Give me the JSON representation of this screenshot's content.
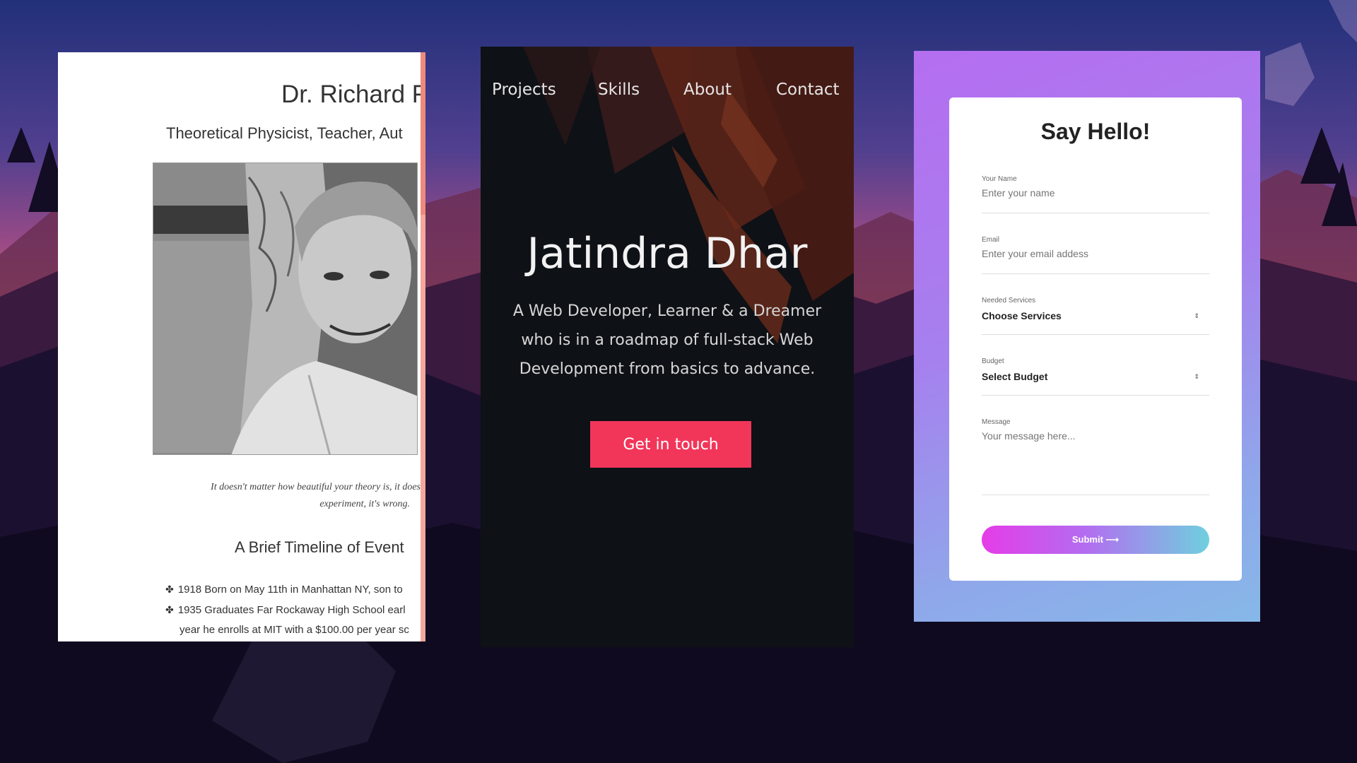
{
  "tribute": {
    "title": "Dr. Richard F",
    "subtitle": "Theoretical Physicist, Teacher, Aut",
    "quote_line1": "It doesn't matter how beautiful your theory is, it doesn",
    "quote_line2": "experiment, it's wrong.",
    "timeline_heading": "A Brief Timeline of Event",
    "timeline": [
      "1918 Born on May 11th in Manhattan NY, son to",
      "1935 Graduates Far Rockaway High School earl",
      "year he enrolls at MIT with a $100.00 per year sc"
    ],
    "bullet": "✤"
  },
  "portfolio": {
    "nav": [
      "Projects",
      "Skills",
      "About",
      "Contact"
    ],
    "name": "Jatindra Dhar",
    "description": [
      "A Web Developer, Learner & a Dreamer",
      "who is in a roadmap of full-stack Web",
      "Development from basics to advance."
    ],
    "cta": "Get in touch",
    "accent": "#f2365a"
  },
  "contact_form": {
    "title": "Say Hello!",
    "name_label": "Your Name",
    "name_placeholder": "Enter your name",
    "email_label": "Email",
    "email_placeholder": "Enter your email addess",
    "services_label": "Needed Services",
    "services_value": "Choose Services",
    "budget_label": "Budget",
    "budget_value": "Select Budget",
    "message_label": "Message",
    "message_placeholder": "Your message here...",
    "submit": "Submit ⟶",
    "select_arrow": "⇕"
  }
}
